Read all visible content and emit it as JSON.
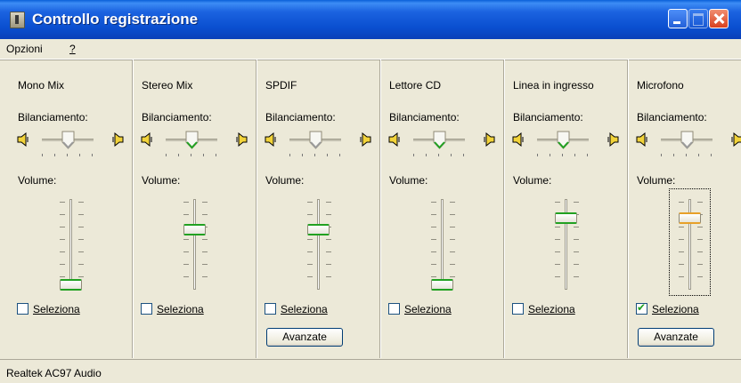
{
  "window": {
    "title": "Controllo registrazione"
  },
  "menu": [
    "Opzioni",
    "?"
  ],
  "labels": {
    "balance": "Bilanciamento:",
    "volume": "Volume:",
    "select": "Seleziona",
    "advanced": "Avanzate"
  },
  "channels": [
    {
      "name": "Mono Mix",
      "volume_pct": 0,
      "selected": false,
      "balance_color": "neutral",
      "has_advanced": false
    },
    {
      "name": "Stereo Mix",
      "volume_pct": 66,
      "selected": false,
      "balance_color": "green",
      "has_advanced": false
    },
    {
      "name": "SPDIF",
      "volume_pct": 66,
      "selected": false,
      "balance_color": "neutral",
      "has_advanced": true
    },
    {
      "name": "Lettore CD",
      "volume_pct": 0,
      "selected": false,
      "balance_color": "green",
      "has_advanced": false
    },
    {
      "name": "Linea in ingresso",
      "volume_pct": 80,
      "selected": false,
      "balance_color": "green",
      "has_advanced": false
    },
    {
      "name": "Microfono",
      "volume_pct": 80,
      "selected": true,
      "balance_color": "neutral",
      "has_advanced": true
    }
  ],
  "status": {
    "text": "Realtek AC97 Audio"
  },
  "colors": {
    "title_bar": "#0a4fd0",
    "background": "#ece9d8",
    "green": "#21a121",
    "amber": "#e7a028"
  }
}
